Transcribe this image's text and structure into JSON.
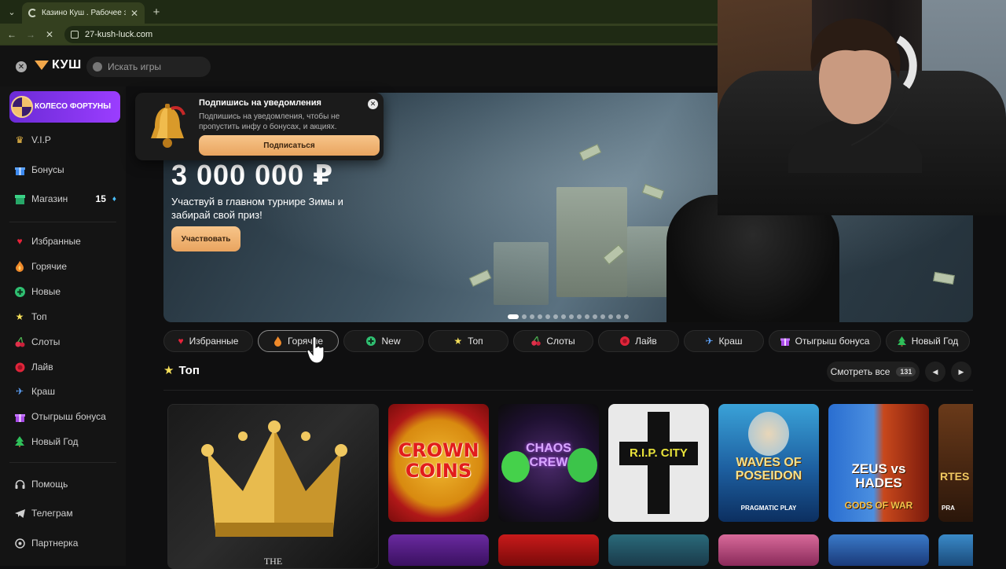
{
  "browser": {
    "tab_title": "Казино Куш . Рабочее зеркало",
    "url": "27-kush-luck.com"
  },
  "header": {
    "logo_text": "КУШ",
    "search_placeholder": "Искать игры"
  },
  "sidebar": {
    "wheel_label": "КОЛЕСО ФОРТУНЫ",
    "top_items": [
      {
        "label": "V.I.P",
        "icon": "crown-icon"
      },
      {
        "label": "Бонусы",
        "icon": "gift-icon"
      },
      {
        "label": "Магазин",
        "icon": "shop-icon",
        "badge": "15"
      }
    ],
    "categories": [
      {
        "label": "Избранные",
        "icon": "heart-icon"
      },
      {
        "label": "Горячие",
        "icon": "fire-icon"
      },
      {
        "label": "Новые",
        "icon": "plus-icon"
      },
      {
        "label": "Топ",
        "icon": "star-icon"
      },
      {
        "label": "Слоты",
        "icon": "cherry-icon"
      },
      {
        "label": "Лайв",
        "icon": "chip-icon"
      },
      {
        "label": "Краш",
        "icon": "plane-icon"
      },
      {
        "label": "Отыгрыш бонуса",
        "icon": "gift-icon"
      },
      {
        "label": "Новый Год",
        "icon": "tree-icon"
      }
    ],
    "bottom_items": [
      {
        "label": "Помощь",
        "icon": "headset-icon"
      },
      {
        "label": "Телеграм",
        "icon": "telegram-icon"
      },
      {
        "label": "Партнерка",
        "icon": "partner-icon"
      }
    ]
  },
  "banner": {
    "prize": "3 000 000 ₽",
    "description": "Участвуй в главном турнире Зимы и забирай свой приз!",
    "button": "Участвовать",
    "slide_count": 15,
    "active_slide": 1
  },
  "notification": {
    "title": "Подпишись на уведомления",
    "text": "Подпишись на уведомления, чтобы не пропустить инфу о бонусах, и акциях.",
    "button": "Подписаться"
  },
  "category_pills": [
    {
      "label": "Избранные",
      "icon": "heart-icon"
    },
    {
      "label": "Горячие",
      "icon": "fire-icon",
      "active": true
    },
    {
      "label": "New",
      "icon": "plus-icon"
    },
    {
      "label": "Топ",
      "icon": "star-icon"
    },
    {
      "label": "Слоты",
      "icon": "cherry-icon"
    },
    {
      "label": "Лайв",
      "icon": "chip-icon"
    },
    {
      "label": "Краш",
      "icon": "plane-icon"
    },
    {
      "label": "Отыгрыш бонуса",
      "icon": "gift-icon"
    },
    {
      "label": "Новый Год",
      "icon": "tree-icon"
    }
  ],
  "section": {
    "title": "Топ",
    "see_all": "Смотреть все",
    "count": "131"
  },
  "games": [
    {
      "title": "THE",
      "subtitle": ""
    },
    {
      "title": "CROWN COINS",
      "subtitle": ""
    },
    {
      "title": "CHAOS CREW",
      "subtitle": ""
    },
    {
      "title": "R.I.P. CITY",
      "subtitle": ""
    },
    {
      "title": "WAVES OF POSEIDON",
      "subtitle": "PRAGMATIC PLAY"
    },
    {
      "title": "ZEUS vs HADES",
      "subtitle": "GODS OF WAR"
    },
    {
      "title": "RTES",
      "subtitle": "PRA"
    }
  ],
  "colors": {
    "accent": "#f3a84a",
    "wheel": "#8b35f0",
    "button": "#eeb170",
    "background": "#0f0f10"
  }
}
